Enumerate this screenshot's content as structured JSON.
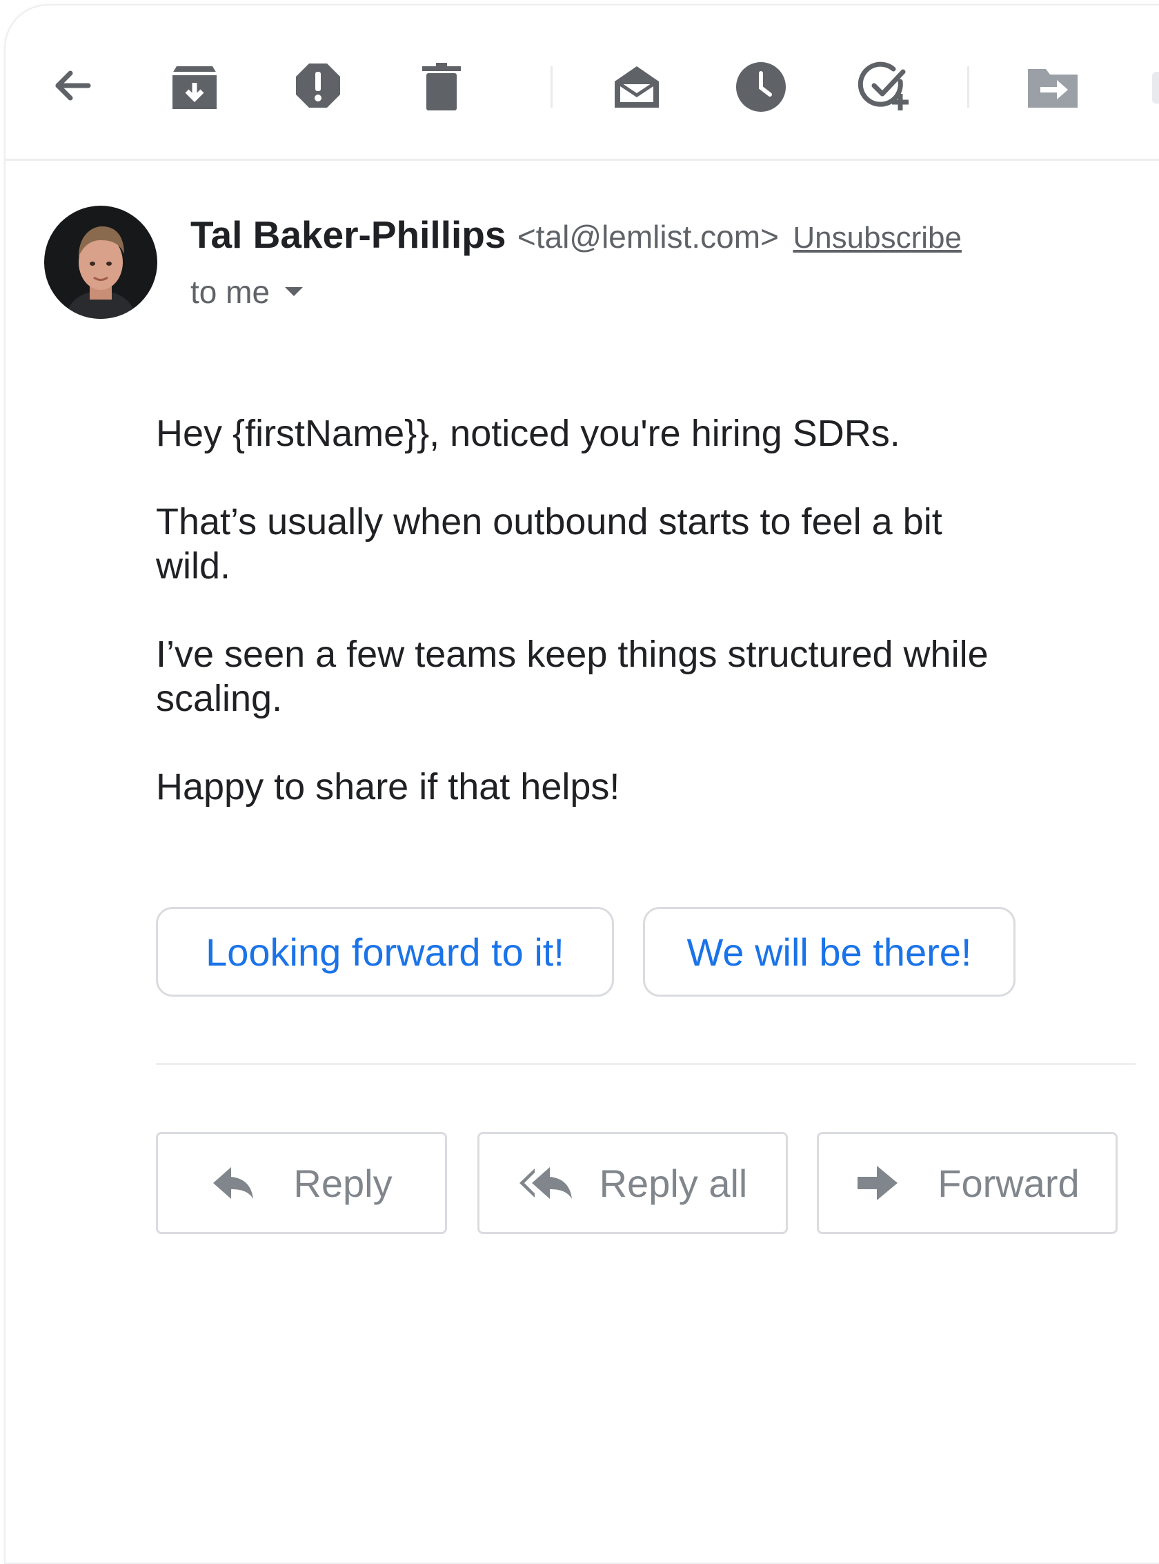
{
  "toolbar": {
    "icons": [
      "back-arrow-icon",
      "archive-icon",
      "report-spam-icon",
      "delete-icon",
      "mark-unread-icon",
      "snooze-icon",
      "add-to-tasks-icon",
      "move-to-icon"
    ]
  },
  "message": {
    "sender_name": "Tal Baker-Phillips",
    "sender_email": "<tal@lemlist.com>",
    "unsubscribe": "Unsubscribe",
    "recipient": "to me",
    "body": [
      "Hey {firstName}}, noticed you're hiring SDRs.",
      "That’s usually when outbound starts to feel a bit wild.",
      "I’ve seen a few teams keep things structured while scaling.",
      "Happy to share if that helps!"
    ]
  },
  "smart_replies": [
    "Looking forward to it!",
    "We will be there!"
  ],
  "actions": {
    "reply": "Reply",
    "reply_all": "Reply all",
    "forward": "Forward"
  },
  "colors": {
    "accent": "#1a73e8",
    "icon": "#5f6368",
    "muted": "#80868b",
    "border": "#dadce0"
  }
}
